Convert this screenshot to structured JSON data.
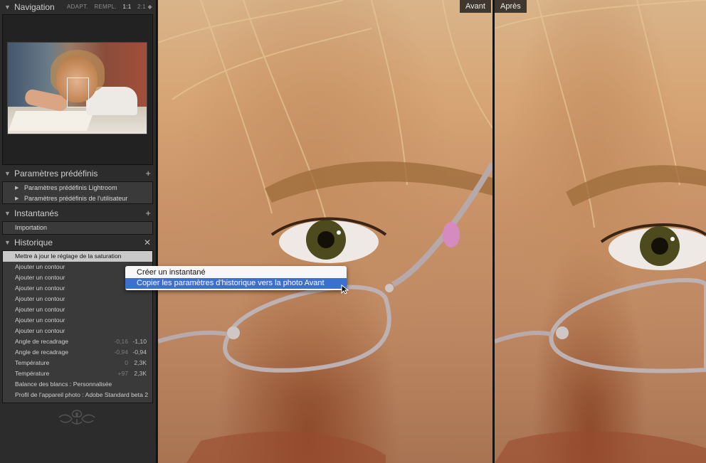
{
  "nav": {
    "title": "Navigation",
    "options": [
      "ADAPT.",
      "REMPL.",
      "1:1",
      "2:1 ◆"
    ],
    "selected_option": "1:1"
  },
  "presets": {
    "title": "Paramètres prédéfinis",
    "items": [
      "Paramètres prédéfinis Lightroom",
      "Paramètres prédéfinis de l'utilisateur"
    ]
  },
  "snapshots": {
    "title": "Instantanés",
    "items": [
      "Importation"
    ]
  },
  "history": {
    "title": "Historique",
    "items": [
      {
        "label": "Mettre à jour le réglage de la saturation",
        "v1": "",
        "v2": ""
      },
      {
        "label": "Ajouter un contour",
        "v1": "",
        "v2": ""
      },
      {
        "label": "Ajouter un contour",
        "v1": "",
        "v2": ""
      },
      {
        "label": "Ajouter un contour",
        "v1": "",
        "v2": ""
      },
      {
        "label": "Ajouter un contour",
        "v1": "",
        "v2": ""
      },
      {
        "label": "Ajouter un contour",
        "v1": "",
        "v2": ""
      },
      {
        "label": "Ajouter un contour",
        "v1": "",
        "v2": ""
      },
      {
        "label": "Ajouter un contour",
        "v1": "",
        "v2": ""
      },
      {
        "label": "Angle de recadrage",
        "v1": "-0,16",
        "v2": "-1,10"
      },
      {
        "label": "Angle de recadrage",
        "v1": "-0,94",
        "v2": "-0,94"
      },
      {
        "label": "Température",
        "v1": "0",
        "v2": "2,3K"
      },
      {
        "label": "Température",
        "v1": "+97",
        "v2": "2,3K"
      },
      {
        "label": "Balance des blancs : Personnalisée",
        "v1": "",
        "v2": ""
      },
      {
        "label": "Profil de l'appareil photo : Adobe Standard beta 2",
        "v1": "",
        "v2": ""
      }
    ]
  },
  "view": {
    "before_label": "Avant",
    "after_label": "Après"
  },
  "context_menu": {
    "items": [
      "Créer un instantané",
      "Copier les paramètres d'historique vers la photo Avant"
    ]
  }
}
